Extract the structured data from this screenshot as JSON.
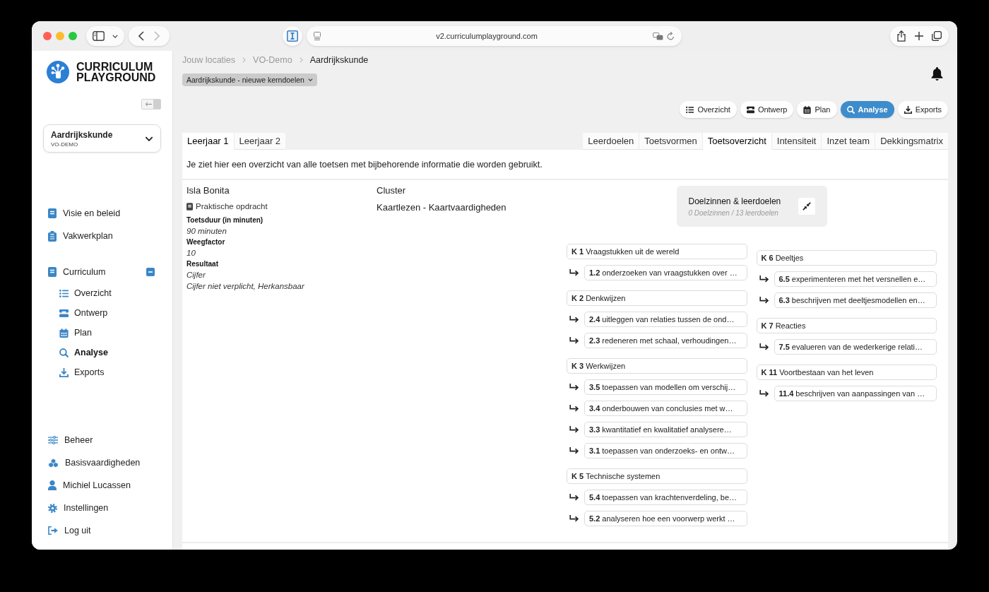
{
  "browser": {
    "url": "v2.curriculumplayground.com"
  },
  "sidebar": {
    "logo_text": "CURRICULUM PLAYGROUND",
    "subject": {
      "title": "Aardrijkskunde",
      "subtitle": "VO-DEMO"
    },
    "nav_top": [
      {
        "kind": "link",
        "label": "Visie en beleid"
      },
      {
        "kind": "link",
        "label": "Vakwerkplan"
      },
      {
        "kind": "group",
        "label": "Curriculum",
        "expanded": true,
        "children": [
          {
            "label": "Overzicht",
            "selected": false
          },
          {
            "label": "Ontwerp",
            "selected": false
          },
          {
            "label": "Plan",
            "selected": false
          },
          {
            "label": "Analyse",
            "selected": true
          },
          {
            "label": "Exports",
            "selected": false
          }
        ]
      }
    ],
    "nav_bottom": [
      {
        "label": "Beheer"
      },
      {
        "label": "Basisvaardigheden"
      },
      {
        "label": "Michiel Lucassen"
      },
      {
        "label": "Instellingen"
      },
      {
        "label": "Log uit"
      }
    ]
  },
  "header": {
    "breadcrumb": [
      {
        "label": "Jouw locaties",
        "current": false
      },
      {
        "label": "VO-Demo",
        "current": false
      },
      {
        "label": "Aardrijkskunde",
        "current": true
      }
    ],
    "curriculum_select": "Aardrijkskunde - nieuwe kerndoelen",
    "view_buttons": [
      {
        "label": "Overzicht",
        "selected": false
      },
      {
        "label": "Ontwerp",
        "selected": false
      },
      {
        "label": "Plan",
        "selected": false
      },
      {
        "label": "Analyse",
        "selected": true
      },
      {
        "label": "Exports",
        "selected": false
      }
    ]
  },
  "year_tabs": [
    {
      "label": "Leerjaar 1",
      "selected": true
    },
    {
      "label": "Leerjaar 2",
      "selected": false
    }
  ],
  "analysis_tabs": [
    {
      "label": "Leerdoelen",
      "selected": false
    },
    {
      "label": "Toetsvormen",
      "selected": false
    },
    {
      "label": "Toetsoverzicht",
      "selected": true
    },
    {
      "label": "Intensiteit",
      "selected": false
    },
    {
      "label": "Inzet team",
      "selected": false
    },
    {
      "label": "Dekkingsmatrix",
      "selected": false
    }
  ],
  "intro": "Je ziet hier een overzicht van alle toetsen met bijbehorende informatie die worden gebruikt.",
  "tests": [
    {
      "name": "Isla Bonita",
      "type": "Praktische opdracht",
      "fields": [
        {
          "label": "Toetsduur (in minuten)",
          "values": [
            "90 minuten"
          ]
        },
        {
          "label": "Weegfactor",
          "values": [
            "10"
          ]
        },
        {
          "label": "Resultaat",
          "values": [
            "Cijfer",
            "Cijfer niet verplicht, Herkansbaar"
          ]
        }
      ],
      "cluster_label": "Cluster",
      "cluster": "Kaartlezen - Kaartvaardigheden",
      "goals_panel": {
        "title": "Doelzinnen & leerdoelen",
        "count": "0 Doelzinnen / 13 leerdoelen",
        "expanded": true
      },
      "goal_columns": [
        {
          "groups": [
            {
              "code": "K 1",
              "title": "Vraagstukken uit de wereld",
              "objectives": [
                {
                  "code": "1.2",
                  "text": "onderzoeken van vraagstukken over …"
                }
              ]
            },
            {
              "code": "K 2",
              "title": "Denkwijzen",
              "objectives": [
                {
                  "code": "2.4",
                  "text": "uitleggen van relaties tussen de ond…"
                },
                {
                  "code": "2.3",
                  "text": "redeneren met schaal, verhoudingen…"
                }
              ]
            },
            {
              "code": "K 3",
              "title": "Werkwijzen",
              "objectives": [
                {
                  "code": "3.5",
                  "text": "toepassen van modellen om verschij…"
                },
                {
                  "code": "3.4",
                  "text": "onderbouwen van conclusies met w…"
                },
                {
                  "code": "3.3",
                  "text": "kwantitatief en kwalitatief analysere…"
                },
                {
                  "code": "3.1",
                  "text": "toepassen van onderzoeks- en ontw…"
                }
              ]
            },
            {
              "code": "K 5",
              "title": "Technische systemen",
              "objectives": [
                {
                  "code": "5.4",
                  "text": "toepassen van krachtenverdeling, be…"
                },
                {
                  "code": "5.2",
                  "text": "analyseren hoe een voorwerp werkt …"
                }
              ]
            }
          ]
        },
        {
          "groups": [
            {
              "code": "K 6",
              "title": "Deeltjes",
              "objectives": [
                {
                  "code": "6.5",
                  "text": "experimenteren met het versnellen e…"
                },
                {
                  "code": "6.3",
                  "text": "beschrijven met deeltjesmodellen en…"
                }
              ]
            },
            {
              "code": "K 7",
              "title": "Reacties",
              "objectives": [
                {
                  "code": "7.5",
                  "text": "evalueren van de wederkerige relati…"
                }
              ]
            },
            {
              "code": "K 11",
              "title": "Voortbestaan van het leven",
              "objectives": [
                {
                  "code": "11.4",
                  "text": "beschrijven van aanpassingen van …"
                }
              ]
            }
          ]
        }
      ]
    }
  ]
}
